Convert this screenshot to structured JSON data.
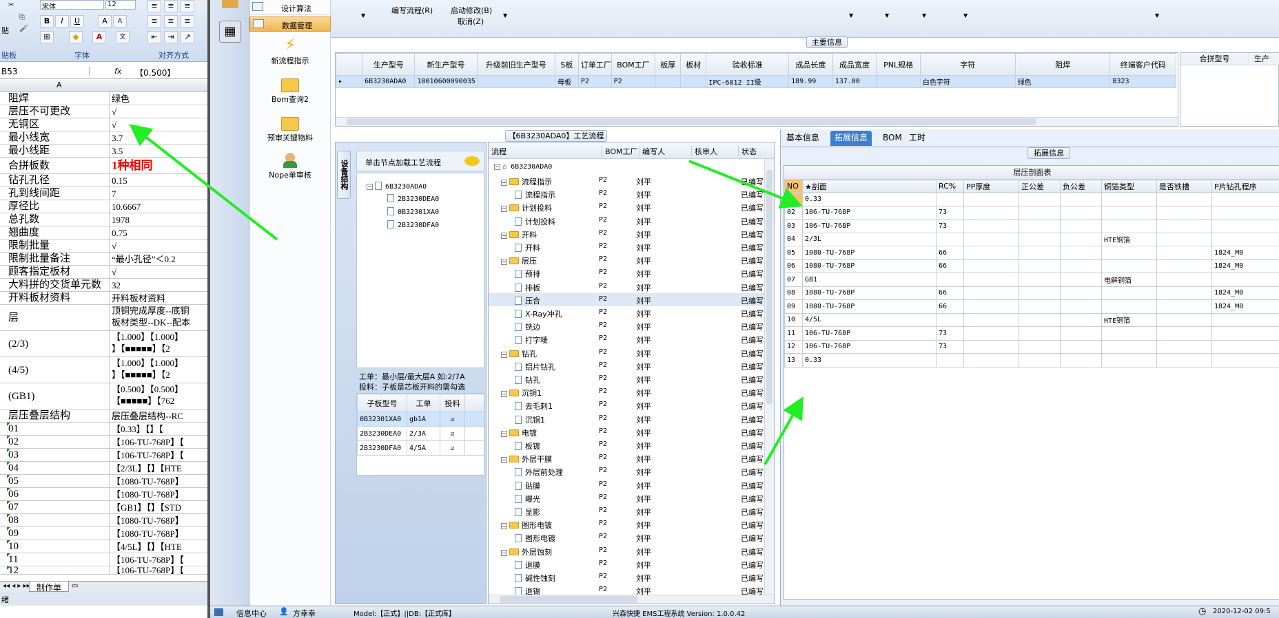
{
  "excel": {
    "font_name": "宋体",
    "font_size": "12",
    "paste_label": "贴",
    "clipboard_group": "贴板",
    "font_group": "字体",
    "align_group": "对齐方式",
    "name_box": "B53",
    "fx_label": "fx",
    "formula_value": "【0.500】",
    "col_a": "A",
    "sheet_tab": "制作单",
    "rows": [
      {
        "a": "阻焊",
        "b": "绿色",
        "h": 19,
        "mk": false
      },
      {
        "a": "层压不可更改",
        "b": "√",
        "h": 19,
        "mk": false
      },
      {
        "a": "无铜区",
        "b": "√",
        "h": 19,
        "mk": false
      },
      {
        "a": "最小线宽",
        "b": "3.7",
        "h": 19,
        "mk": false
      },
      {
        "a": "最小线距",
        "b": "3.5",
        "h": 19,
        "mk": false
      },
      {
        "a": "合拼板数",
        "b": "1种相同",
        "h": 24,
        "mk": false,
        "red": true
      },
      {
        "a": "钻孔孔径",
        "b": "0.15",
        "h": 19,
        "mk": false
      },
      {
        "a": "孔到线间距",
        "b": "7",
        "h": 19,
        "mk": false
      },
      {
        "a": "厚径比",
        "b": "10.6667",
        "h": 19,
        "mk": false
      },
      {
        "a": "总孔数",
        "b": "1978",
        "h": 19,
        "mk": false
      },
      {
        "a": "翘曲度",
        "b": "0.75",
        "h": 19,
        "mk": false
      },
      {
        "a": "限制批量",
        "b": "√",
        "h": 19,
        "mk": false
      },
      {
        "a": "限制批量备注",
        "b": "“最小孔径”＜0.2",
        "h": 19,
        "mk": false
      },
      {
        "a": "顾客指定板材",
        "b": "√",
        "h": 19,
        "mk": false
      },
      {
        "a": "大料拼的交货单元数",
        "b": "32",
        "h": 19,
        "mk": false
      },
      {
        "a": "开料板材资料",
        "b": "开料板材资料",
        "h": 19,
        "mk": false
      },
      {
        "a": "层",
        "b": "顶铜完成厚度--底铜",
        "b2": "板材类型--DK--配本",
        "h": 38,
        "mk": false
      },
      {
        "a": "(2/3)",
        "b": "【1.000】【1.000】",
        "b2": "】【■■■■■】【2",
        "h": 38,
        "mk": false
      },
      {
        "a": "(4/5)",
        "b": "【1.000】【1.000】",
        "b2": "】【■■■■■】【2",
        "h": 38,
        "mk": false
      },
      {
        "a": "(GB1)",
        "b": "【0.500】【0.500】",
        "b2": "【■■■■■】【762",
        "h": 38,
        "mk": false
      },
      {
        "a": "层压叠层结构",
        "b": "层压叠层结构--RC",
        "h": 19,
        "mk": false
      },
      {
        "a": "01",
        "b": "【0.33】【】【",
        "h": 19,
        "mk": true
      },
      {
        "a": "02",
        "b": "【106-TU-768P】【",
        "h": 19,
        "mk": true
      },
      {
        "a": "03",
        "b": "【106-TU-768P】【",
        "h": 19,
        "mk": true
      },
      {
        "a": "04",
        "b": "【2/3L】【】【HTE",
        "h": 19,
        "mk": true
      },
      {
        "a": "05",
        "b": "【1080-TU-768P】",
        "h": 19,
        "mk": true
      },
      {
        "a": "06",
        "b": "【1080-TU-768P】",
        "h": 19,
        "mk": true
      },
      {
        "a": "07",
        "b": "【GB1】【】【STD",
        "h": 19,
        "mk": true
      },
      {
        "a": "08",
        "b": "【1080-TU-768P】",
        "h": 19,
        "mk": true
      },
      {
        "a": "09",
        "b": "【1080-TU-768P】",
        "h": 19,
        "mk": true
      },
      {
        "a": "10",
        "b": "【4/5L】【】【HTE",
        "h": 19,
        "mk": true
      },
      {
        "a": "11",
        "b": "【106-TU-768P】【",
        "h": 19,
        "mk": true
      },
      {
        "a": "12",
        "b": "【106-TU-768P】【",
        "h": 12,
        "mk": true
      }
    ]
  },
  "nav": {
    "items": [
      "设计算法",
      "数据管理"
    ],
    "actions": [
      "新流程指示",
      "Bom查询2",
      "预审关键物料",
      "Nope单审核"
    ]
  },
  "toolbar": {
    "edit_flow": "编写流程(R)",
    "start_edit": "启动修改(B)",
    "cancel": "取消(Z)"
  },
  "main_info": {
    "title": "主要信息",
    "columns": [
      "生产型号",
      "新生产型号",
      "升级前旧生产型号",
      "S板",
      "订单工厂",
      "BOM工厂",
      "板厚",
      "板材",
      "验收标准",
      "成品长度",
      "成品宽度",
      "PNL规格",
      "字符",
      "阻焊",
      "终端客户代码"
    ],
    "row": [
      "6B3230ADA0",
      "10010600090035",
      "",
      "母板",
      "P2",
      "P2",
      "",
      "",
      "IPC-6012 II级",
      "189.99",
      "137.00",
      "",
      "白色字符",
      "绿色",
      "B323"
    ],
    "right_cols": [
      "合拼型号",
      "生产"
    ]
  },
  "flow": {
    "title": "【6B3230ADA0】工艺流程",
    "side_tab": "设备结构",
    "load_hint": "单击节点加载工艺流程",
    "root": "6B3230ADA0",
    "children": [
      "2B3230DEA0",
      "0B32301XA0",
      "2B3230DFA0"
    ],
    "note1": "工单：最小层/最大层A 如:2/7A",
    "note2": "投料：子板是芯板开料的需勾选",
    "sub_cols": [
      "子板型号",
      "工单",
      "投料"
    ],
    "sub_rows": [
      [
        "0B32301XA0",
        "gb1A"
      ],
      [
        "2B3230DEA0",
        "2/3A"
      ],
      [
        "2B3230DFA0",
        "4/5A"
      ]
    ],
    "cols": [
      "流程",
      "BOM工厂",
      "编写人",
      "核审人",
      "状态"
    ],
    "top": "6B3230ADA0",
    "rows": [
      {
        "lvl": 1,
        "n": "流程指示"
      },
      {
        "lvl": 2,
        "n": "流程指示"
      },
      {
        "lvl": 1,
        "n": "计划投料"
      },
      {
        "lvl": 2,
        "n": "计划投料"
      },
      {
        "lvl": 1,
        "n": "开料"
      },
      {
        "lvl": 2,
        "n": "开料"
      },
      {
        "lvl": 1,
        "n": "层压"
      },
      {
        "lvl": 2,
        "n": "预排"
      },
      {
        "lvl": 2,
        "n": "排板"
      },
      {
        "lvl": 2,
        "n": "压合"
      },
      {
        "lvl": 2,
        "n": "X-Ray冲孔"
      },
      {
        "lvl": 2,
        "n": "铣边"
      },
      {
        "lvl": 2,
        "n": "打字唛"
      },
      {
        "lvl": 1,
        "n": "钻孔"
      },
      {
        "lvl": 2,
        "n": "铝片钻孔"
      },
      {
        "lvl": 2,
        "n": "钻孔"
      },
      {
        "lvl": 1,
        "n": "沉铜1"
      },
      {
        "lvl": 2,
        "n": "去毛刺1"
      },
      {
        "lvl": 2,
        "n": "沉铜1"
      },
      {
        "lvl": 1,
        "n": "电镀"
      },
      {
        "lvl": 2,
        "n": "板镀"
      },
      {
        "lvl": 1,
        "n": "外层干膜"
      },
      {
        "lvl": 2,
        "n": "外层前处理"
      },
      {
        "lvl": 2,
        "n": "贴膜"
      },
      {
        "lvl": 2,
        "n": "曝光"
      },
      {
        "lvl": 2,
        "n": "显影"
      },
      {
        "lvl": 1,
        "n": "图形电镀"
      },
      {
        "lvl": 2,
        "n": "图形电镀"
      },
      {
        "lvl": 1,
        "n": "外层蚀刻"
      },
      {
        "lvl": 2,
        "n": "退膜"
      },
      {
        "lvl": 2,
        "n": "碱性蚀刻"
      },
      {
        "lvl": 2,
        "n": "退锡"
      }
    ],
    "factory": "P2",
    "writer": "刘平",
    "status": "已编写"
  },
  "ext": {
    "tabs": [
      "基本信息",
      "拓展信息",
      "BOM",
      "工时"
    ],
    "section": "拓展信息",
    "table_title": "层压剖面表",
    "cols": [
      "NO",
      "★剖面",
      "RC%",
      "PP厚度",
      "正公差",
      "负公差",
      "铜箔类型",
      "是否铁槽",
      "P片钻孔程序"
    ],
    "rows": [
      [
        "01",
        "0.33",
        "",
        "",
        "",
        "",
        "",
        "",
        ""
      ],
      [
        "02",
        "106-TU-768P",
        "73",
        "",
        "",
        "",
        "",
        "",
        ""
      ],
      [
        "03",
        "106-TU-768P",
        "73",
        "",
        "",
        "",
        "",
        "",
        ""
      ],
      [
        "04",
        "2/3L",
        "",
        "",
        "",
        "",
        "HTE铜箔",
        "",
        ""
      ],
      [
        "05",
        "1080-TU-768P",
        "66",
        "",
        "",
        "",
        "",
        "",
        "1824_M0"
      ],
      [
        "06",
        "1080-TU-768P",
        "66",
        "",
        "",
        "",
        "",
        "",
        "1824_M0"
      ],
      [
        "07",
        "GB1",
        "",
        "",
        "",
        "",
        "电解铜箔",
        "",
        ""
      ],
      [
        "08",
        "1080-TU-768P",
        "66",
        "",
        "",
        "",
        "",
        "",
        "1824_M0"
      ],
      [
        "09",
        "1080-TU-768P",
        "66",
        "",
        "",
        "",
        "",
        "",
        "1824_M0"
      ],
      [
        "10",
        "4/5L",
        "",
        "",
        "",
        "",
        "HTE铜箔",
        "",
        ""
      ],
      [
        "11",
        "106-TU-768P",
        "73",
        "",
        "",
        "",
        "",
        "",
        ""
      ],
      [
        "12",
        "106-TU-768P",
        "73",
        "",
        "",
        "",
        "",
        "",
        ""
      ],
      [
        "13",
        "0.33",
        "",
        "",
        "",
        "",
        "",
        "",
        ""
      ]
    ]
  },
  "status": {
    "msg_center": "信息中心",
    "user": "方幸幸",
    "model": "Model:【正式】||DB:【正式库】",
    "system": "兴森快捷 EMS工程系统 Version: 1.0.0.42",
    "datetime": "2020-12-02 09:5"
  },
  "colors": {
    "accent": "#3a7fd0",
    "selected": "#f6c26b",
    "arrow": "#22ee22"
  }
}
